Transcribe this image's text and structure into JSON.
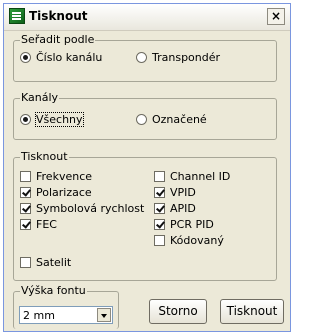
{
  "window": {
    "title": "Tisknout",
    "close_label": "×"
  },
  "sort": {
    "legend": "Seřadit podle",
    "options": [
      {
        "label": "Číslo kanálu",
        "selected": true
      },
      {
        "label": "Transpondér",
        "selected": false
      }
    ]
  },
  "channels": {
    "legend": "Kanály",
    "options": [
      {
        "label": "Všechny",
        "selected": true
      },
      {
        "label": "Označené",
        "selected": false
      }
    ]
  },
  "print": {
    "legend": "Tisknout",
    "left": [
      {
        "label": "Frekvence",
        "checked": false
      },
      {
        "label": "Polarizace",
        "checked": true
      },
      {
        "label": "Symbolová rychlost",
        "checked": true
      },
      {
        "label": "FEC",
        "checked": true
      },
      {
        "label": "Satelit",
        "checked": false
      }
    ],
    "right": [
      {
        "label": "Channel ID",
        "checked": false
      },
      {
        "label": "VPID",
        "checked": true
      },
      {
        "label": "APID",
        "checked": true
      },
      {
        "label": "PCR PID",
        "checked": true
      },
      {
        "label": "Kódovaný",
        "checked": false
      }
    ]
  },
  "font": {
    "legend": "Výška fontu",
    "value": "2 mm"
  },
  "buttons": {
    "cancel": "Storno",
    "print": "Tisknout"
  }
}
